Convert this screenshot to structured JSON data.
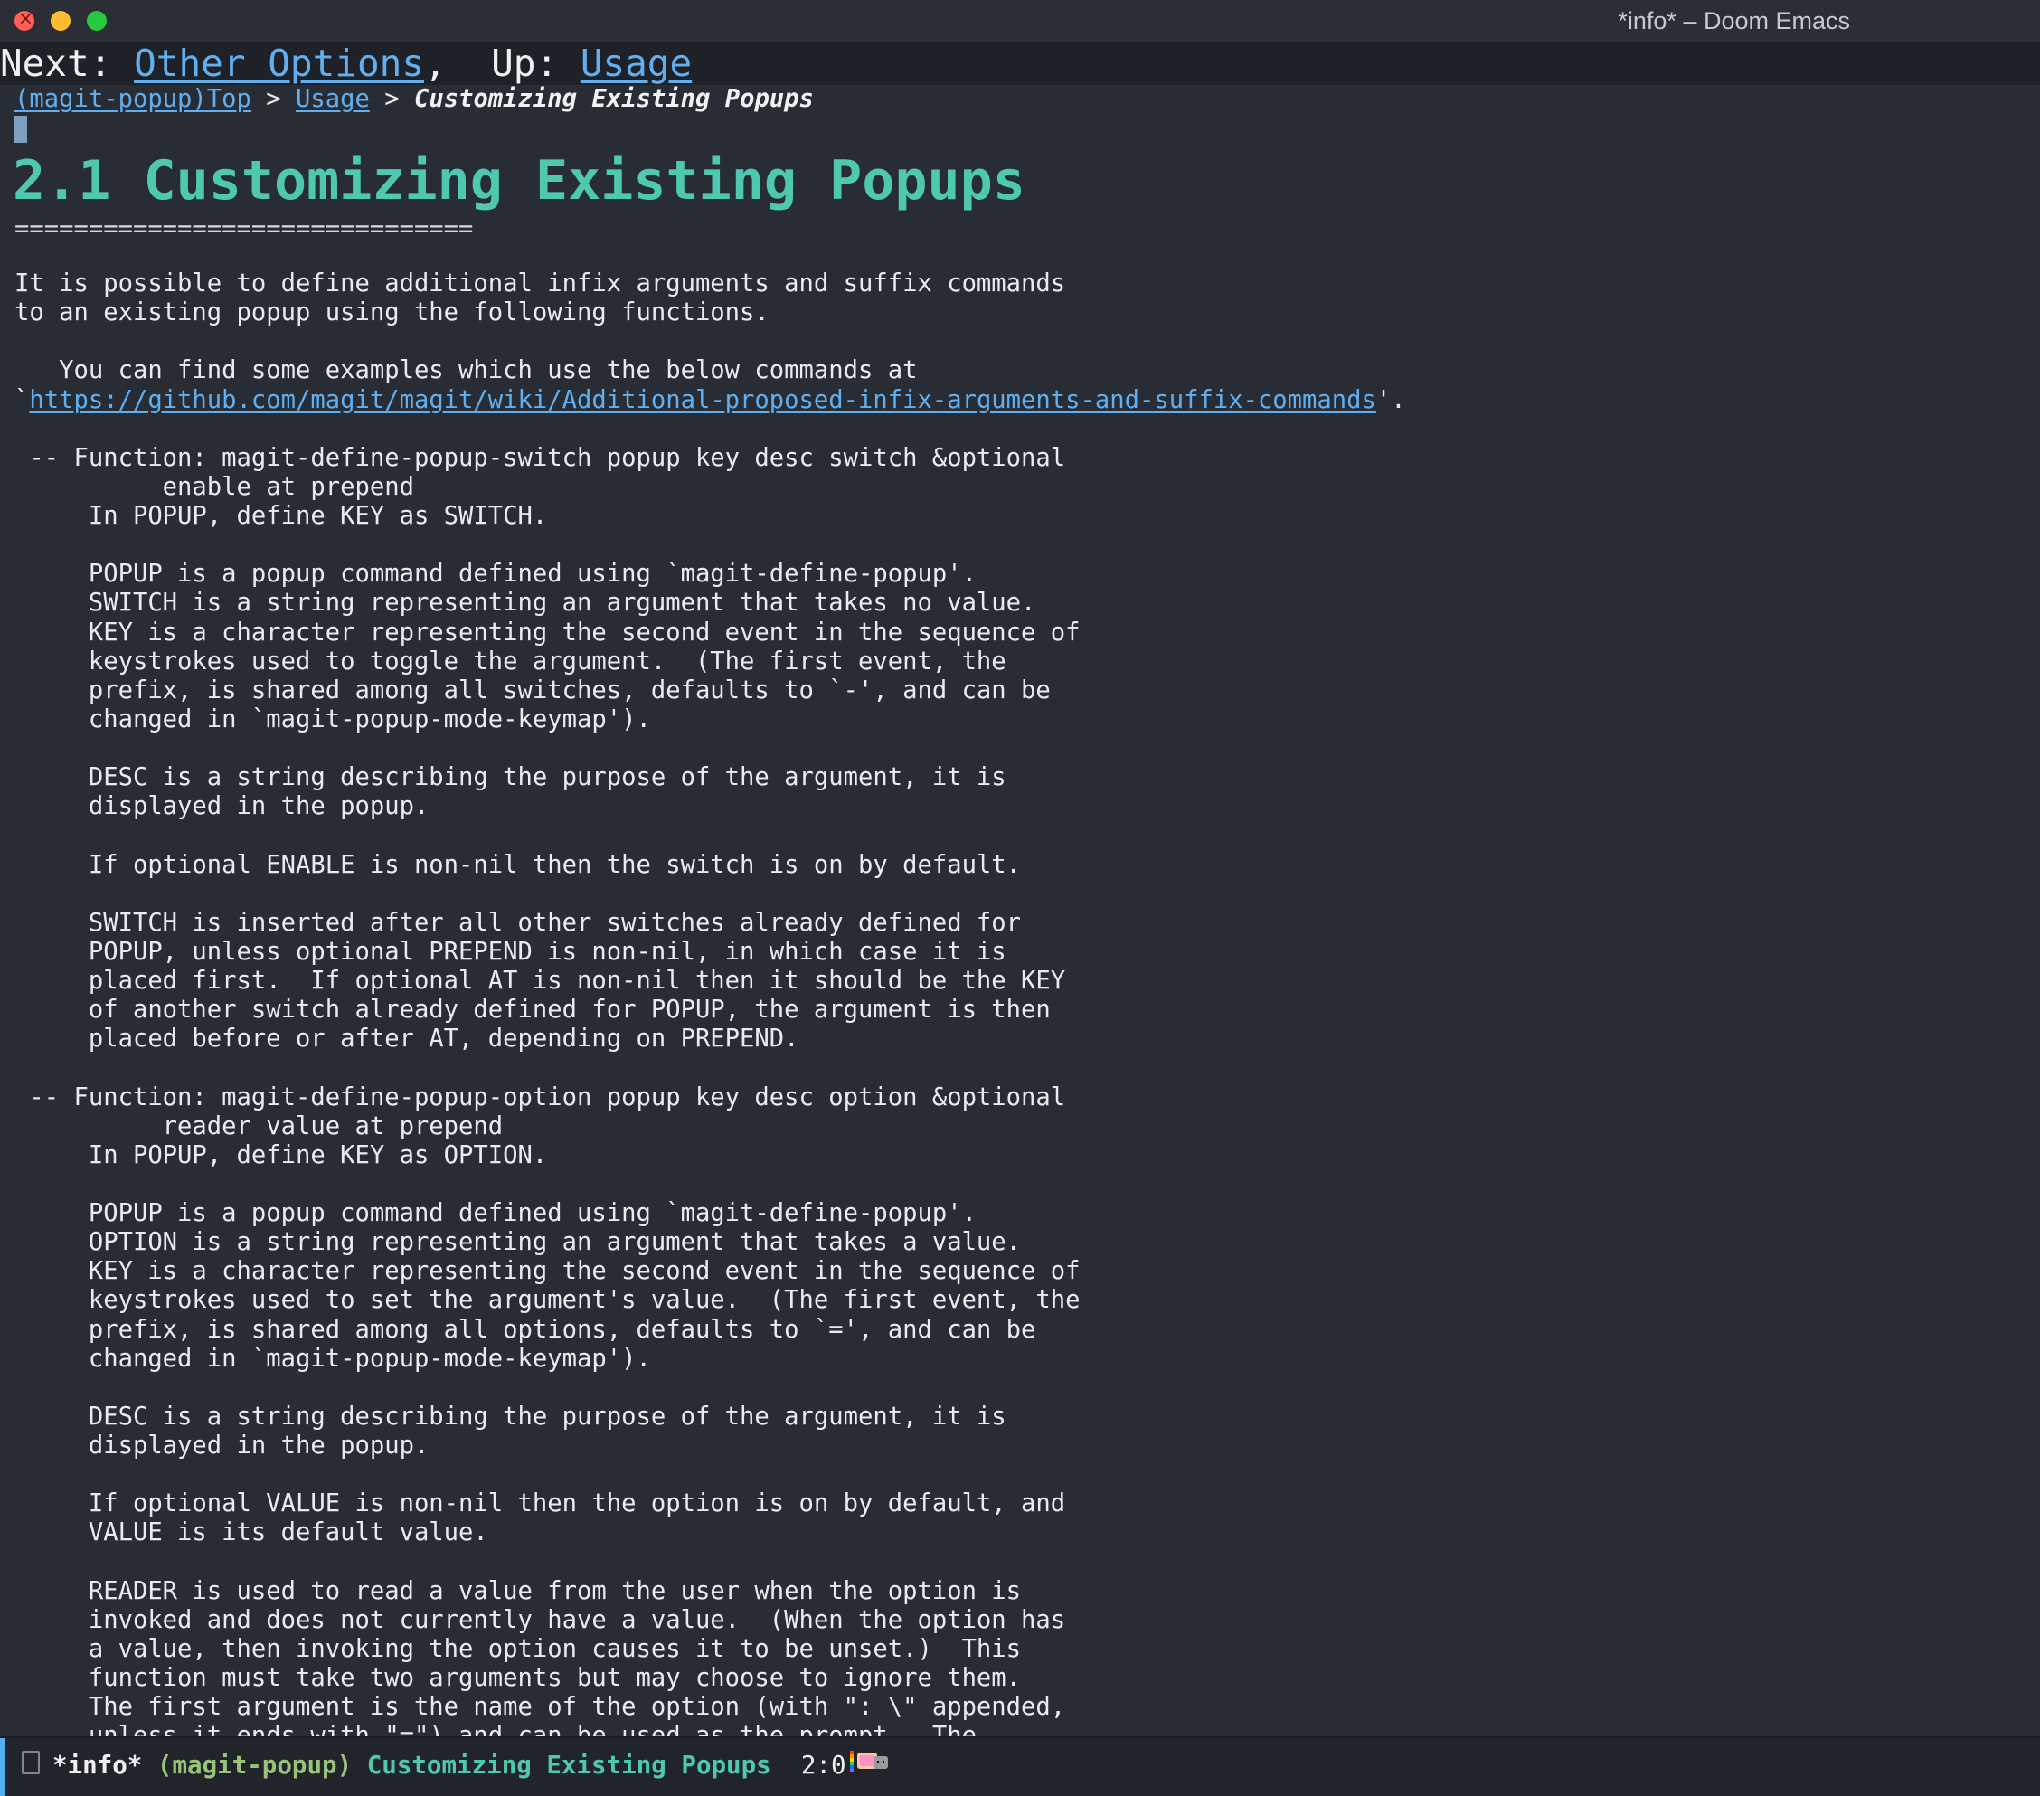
{
  "window": {
    "title": "*info* – Doom Emacs"
  },
  "header": {
    "next_label": "Next: ",
    "next_link": "Other Options",
    "sep": ",  Up: ",
    "up_link": "Usage"
  },
  "breadcrumb": {
    "top": "(magit-popup)Top",
    "sep1": " > ",
    "usage": "Usage",
    "sep2": " > ",
    "current": "Customizing Existing Popups"
  },
  "section": {
    "heading": "2.1 Customizing Existing Popups",
    "underline": "==============================="
  },
  "body": {
    "text_before_url": "It is possible to define additional infix arguments and suffix commands\nto an existing popup using the following functions.\n\n   You can find some examples which use the below commands at\n`",
    "url": "https://github.com/magit/magit/wiki/Additional-proposed-infix-arguments-and-suffix-commands",
    "text_after_url": "'.\n\n -- Function: magit-define-popup-switch popup key desc switch &optional\n          enable at prepend\n     In POPUP, define KEY as SWITCH.\n\n     POPUP is a popup command defined using `magit-define-popup'.\n     SWITCH is a string representing an argument that takes no value.\n     KEY is a character representing the second event in the sequence of\n     keystrokes used to toggle the argument.  (The first event, the\n     prefix, is shared among all switches, defaults to `-', and can be\n     changed in `magit-popup-mode-keymap').\n\n     DESC is a string describing the purpose of the argument, it is\n     displayed in the popup.\n\n     If optional ENABLE is non-nil then the switch is on by default.\n\n     SWITCH is inserted after all other switches already defined for\n     POPUP, unless optional PREPEND is non-nil, in which case it is\n     placed first.  If optional AT is non-nil then it should be the KEY\n     of another switch already defined for POPUP, the argument is then\n     placed before or after AT, depending on PREPEND.\n\n -- Function: magit-define-popup-option popup key desc option &optional\n          reader value at prepend\n     In POPUP, define KEY as OPTION.\n\n     POPUP is a popup command defined using `magit-define-popup'.\n     OPTION is a string representing an argument that takes a value.\n     KEY is a character representing the second event in the sequence of\n     keystrokes used to set the argument's value.  (The first event, the\n     prefix, is shared among all options, defaults to `=', and can be\n     changed in `magit-popup-mode-keymap').\n\n     DESC is a string describing the purpose of the argument, it is\n     displayed in the popup.\n\n     If optional VALUE is non-nil then the option is on by default, and\n     VALUE is its default value.\n\n     READER is used to read a value from the user when the option is\n     invoked and does not currently have a value.  (When the option has\n     a value, then invoking the option causes it to be unset.)  This\n     function must take two arguments but may choose to ignore them.\n     The first argument is the name of the option (with \": \\\" appended,\n     unless it ends with \"=\") and can be used as the prompt.  The"
  },
  "modeline": {
    "buffer": "*info*",
    "module": "(magit-popup)",
    "node": "Customizing Existing Popups",
    "position": "2:0"
  },
  "colors": {
    "background": "#282c34",
    "heading": "#4ec9b0",
    "link": "#61afef",
    "modeline_accent": "#51afef"
  }
}
